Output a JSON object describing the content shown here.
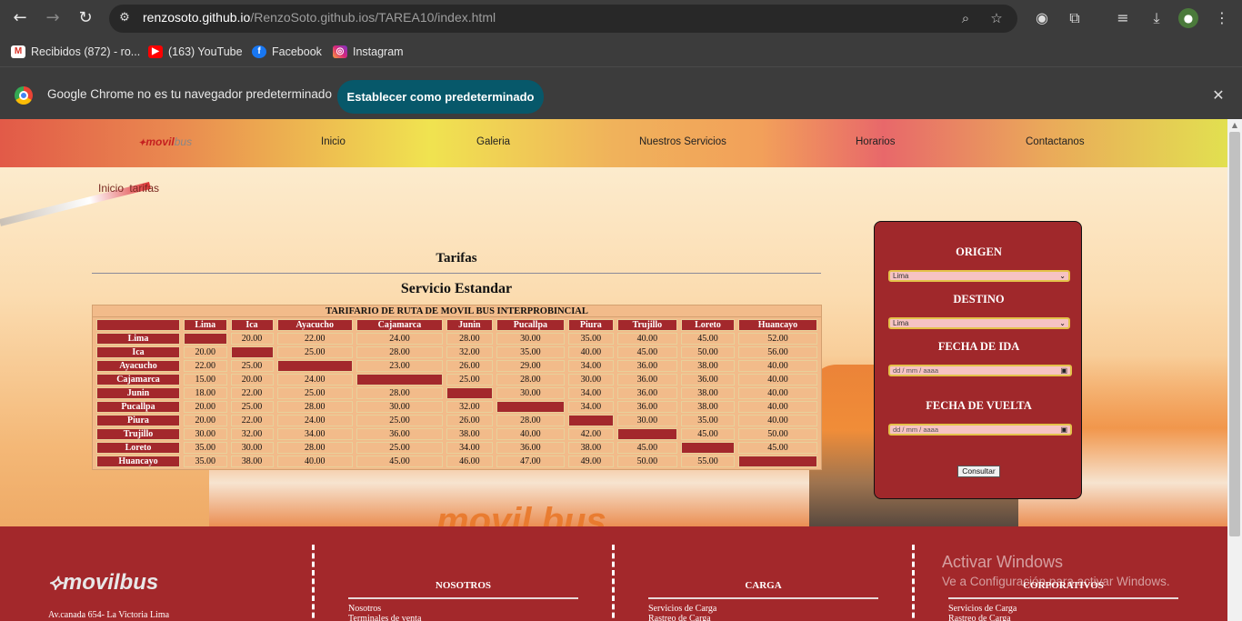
{
  "browser": {
    "url_host": "renzosoto.github.io",
    "url_path": "/RenzoSoto.github.ios/TAREA10/index.html",
    "bookmarks": [
      {
        "label": "Recibidos (872) - ro...",
        "icon": "gmail-icon"
      },
      {
        "label": "(163) YouTube",
        "icon": "youtube-icon"
      },
      {
        "label": "Facebook",
        "icon": "facebook-icon"
      },
      {
        "label": "Instagram",
        "icon": "instagram-icon"
      }
    ],
    "infobar_text": "Google Chrome no es tu navegador predeterminado",
    "infobar_button": "Establecer como predeterminado"
  },
  "site": {
    "logo": {
      "movil": "movil",
      "bus": "bus"
    },
    "nav": [
      "Inicio",
      "Galeria",
      "Nuestros Servicios",
      "Horarios",
      "Contactanos"
    ],
    "breadcrumb": "Inicio  tarifas",
    "page_title": "Tarifas",
    "section_title": "Servicio Estandar",
    "table": {
      "caption": "TARIFARIO DE RUTA DE MOVIL BUS INTERPROBINCIAL",
      "columns": [
        "Lima",
        "Ica",
        "Ayacucho",
        "Cajamarca",
        "Junin",
        "Pucallpa",
        "Piura",
        "Trujillo",
        "Loreto",
        "Huancayo"
      ],
      "rows": [
        {
          "name": "Lima",
          "values": [
            "",
            "20.00",
            "22.00",
            "24.00",
            "28.00",
            "30.00",
            "35.00",
            "40.00",
            "45.00",
            "52.00"
          ]
        },
        {
          "name": "Ica",
          "values": [
            "20.00",
            "",
            "25.00",
            "28.00",
            "32.00",
            "35.00",
            "40.00",
            "45.00",
            "50.00",
            "56.00"
          ]
        },
        {
          "name": "Ayacucho",
          "values": [
            "22.00",
            "25.00",
            "",
            "23.00",
            "26.00",
            "29.00",
            "34.00",
            "36.00",
            "38.00",
            "40.00"
          ]
        },
        {
          "name": "Cajamarca",
          "values": [
            "15.00",
            "20.00",
            "24.00",
            "",
            "25.00",
            "28.00",
            "30.00",
            "36.00",
            "36.00",
            "40.00"
          ]
        },
        {
          "name": "Junin",
          "values": [
            "18.00",
            "22.00",
            "25.00",
            "28.00",
            "",
            "30.00",
            "34.00",
            "36.00",
            "38.00",
            "40.00"
          ]
        },
        {
          "name": "Pucallpa",
          "values": [
            "20.00",
            "25.00",
            "28.00",
            "30.00",
            "32.00",
            "",
            "34.00",
            "36.00",
            "38.00",
            "40.00"
          ]
        },
        {
          "name": "Piura",
          "values": [
            "20.00",
            "22.00",
            "24.00",
            "25.00",
            "26.00",
            "28.00",
            "",
            "30.00",
            "35.00",
            "40.00"
          ]
        },
        {
          "name": "Trujillo",
          "values": [
            "30.00",
            "32.00",
            "34.00",
            "36.00",
            "38.00",
            "40.00",
            "42.00",
            "",
            "45.00",
            "50.00"
          ]
        },
        {
          "name": "Loreto",
          "values": [
            "35.00",
            "30.00",
            "28.00",
            "25.00",
            "34.00",
            "36.00",
            "38.00",
            "45.00",
            "",
            "45.00"
          ]
        },
        {
          "name": "Huancayo",
          "values": [
            "35.00",
            "38.00",
            "40.00",
            "45.00",
            "46.00",
            "47.00",
            "49.00",
            "50.00",
            "55.00",
            ""
          ]
        }
      ]
    },
    "form": {
      "origin_label": "ORIGEN",
      "origin_value": "Lima",
      "destination_label": "DESTINO",
      "destination_value": "Lima",
      "depart_label": "FECHA DE IDA",
      "depart_placeholder": "dd / mm / aaaa",
      "return_label": "FECHA DE VUELTA",
      "return_placeholder": "dd / mm / aaaa",
      "submit_label": "Consultar"
    },
    "background_brand": "movil bus",
    "footer": {
      "logo": "movilbus",
      "address": "Av.canada 654- La Victoria Lima",
      "columns": [
        {
          "heading": "NOSOTROS",
          "links": [
            "Nosotros",
            "Terminales de venta"
          ]
        },
        {
          "heading": "CARGA",
          "links": [
            "Servicios de Carga",
            "Rastreo de Carga"
          ]
        },
        {
          "heading": "CORPORATIVOS",
          "links": [
            "Servicios de Carga",
            "Rastreo de Carga"
          ]
        }
      ]
    }
  },
  "os_overlay": {
    "title": "Activar Windows",
    "subtitle": "Ve a Configuración para activar Windows."
  },
  "colors": {
    "accent_red": "#a3282c",
    "table_bg": "#f2bb8a",
    "button_teal": "#07586a"
  }
}
